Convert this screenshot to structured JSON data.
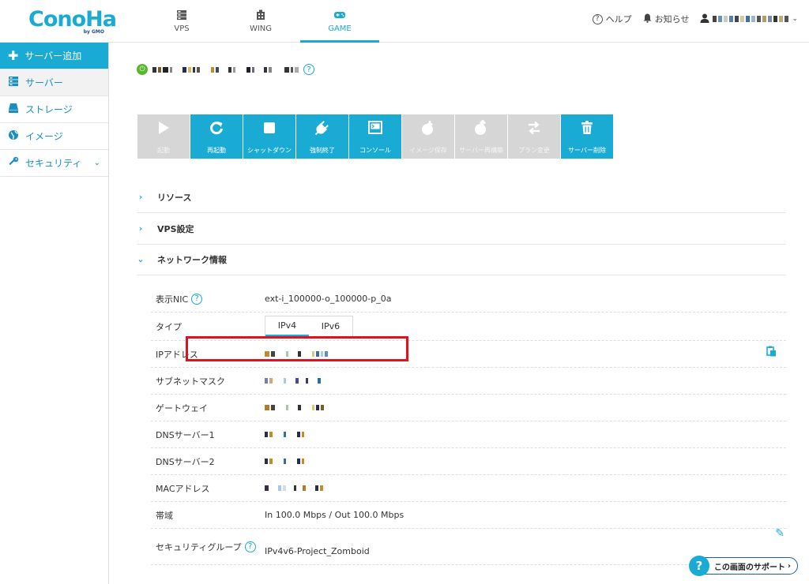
{
  "header": {
    "logo": "ConoHa",
    "logo_sub": "by GMO",
    "nav": [
      {
        "label": "VPS",
        "icon": "server-stack-icon"
      },
      {
        "label": "WING",
        "icon": "building-icon"
      },
      {
        "label": "GAME",
        "icon": "gamepad-icon",
        "active": true
      }
    ],
    "help": "ヘルプ",
    "notice": "お知らせ"
  },
  "sidebar": {
    "items": [
      {
        "label": "サーバー追加",
        "icon": "plus-icon"
      },
      {
        "label": "サーバー",
        "icon": "server-icon"
      },
      {
        "label": "ストレージ",
        "icon": "storage-icon"
      },
      {
        "label": "イメージ",
        "icon": "globe-icon"
      },
      {
        "label": "セキュリティ",
        "icon": "key-icon"
      }
    ]
  },
  "actions": [
    {
      "label": "起動",
      "icon": "play-icon",
      "enabled": false
    },
    {
      "label": "再起動",
      "icon": "restart-icon",
      "enabled": true
    },
    {
      "label": "シャットダウン",
      "icon": "stop-icon",
      "enabled": true
    },
    {
      "label": "強制終了",
      "icon": "plug-icon",
      "enabled": true
    },
    {
      "label": "コンソール",
      "icon": "console-icon",
      "enabled": true
    },
    {
      "label": "イメージ保存",
      "icon": "image-save-icon",
      "enabled": false
    },
    {
      "label": "サーバー再構築",
      "icon": "rebuild-icon",
      "enabled": false
    },
    {
      "label": "プラン変更",
      "icon": "plan-change-icon",
      "enabled": false
    },
    {
      "label": "サーバー削除",
      "icon": "trash-icon",
      "enabled": true
    }
  ],
  "sections": {
    "resources": "リソース",
    "vps_settings": "VPS設定",
    "network_info": "ネットワーク情報"
  },
  "network": {
    "nic_label": "表示NIC",
    "nic_value": "ext-i_100000-o_100000-p_0a",
    "type_label": "タイプ",
    "type_options": [
      "IPv4",
      "IPv6"
    ],
    "type_selected": "IPv4",
    "ip_label": "IPアドレス",
    "subnet_label": "サブネットマスク",
    "gateway_label": "ゲートウェイ",
    "dns1_label": "DNSサーバー1",
    "dns2_label": "DNSサーバー2",
    "mac_label": "MACアドレス",
    "bandwidth_label": "帯域",
    "bandwidth_value": "In 100.0 Mbps / Out 100.0 Mbps",
    "secgroup_label": "セキュリティグループ",
    "secgroup_value": "IPv4v6-Project_Zomboid"
  },
  "support": {
    "label": "この画面のサポート",
    "badge": "?"
  },
  "colors": {
    "accent": "#1aabd5",
    "disabled": "#d6d6d6",
    "highlight": "#e3101e",
    "power_on": "#58b72f"
  }
}
